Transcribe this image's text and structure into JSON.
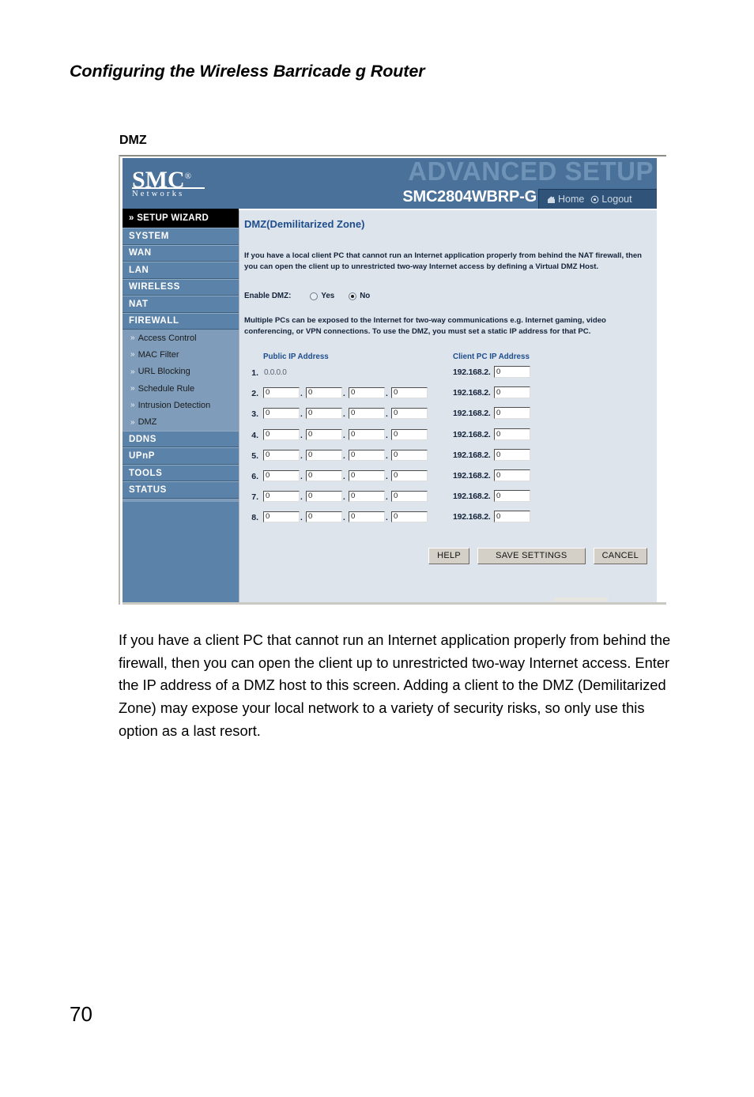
{
  "page": {
    "running_header": "Configuring the Wireless Barricade g Router",
    "section_heading": "DMZ",
    "number": "70",
    "body_paragraph": "If you have a client PC that cannot run an Internet application properly from behind the firewall, then you can open the client up to unrestricted two-way Internet access. Enter the IP address of a DMZ host to this screen. Adding a client to the DMZ (Demilitarized Zone) may expose your local network to a variety of security risks, so only use this option as a last resort."
  },
  "router_ui": {
    "banner": {
      "watermark": "ADVANCED SETUP",
      "logo_main": "SMC",
      "logo_registered": "®",
      "logo_sub": "Networks",
      "model": "SMC2804WBRP-G",
      "nav": [
        {
          "label": "Home",
          "icon": "home-icon"
        },
        {
          "label": "Logout",
          "icon": "logout-icon"
        }
      ]
    },
    "sidebar": {
      "wizard": "» SETUP WIZARD",
      "items": [
        {
          "label": "SYSTEM",
          "type": "main"
        },
        {
          "label": "WAN",
          "type": "main"
        },
        {
          "label": "LAN",
          "type": "main"
        },
        {
          "label": "WIRELESS",
          "type": "main"
        },
        {
          "label": "NAT",
          "type": "main"
        },
        {
          "label": "FIREWALL",
          "type": "main"
        },
        {
          "label": "Access Control",
          "type": "sub"
        },
        {
          "label": "MAC Filter",
          "type": "sub"
        },
        {
          "label": "URL Blocking",
          "type": "sub"
        },
        {
          "label": "Schedule Rule",
          "type": "sub"
        },
        {
          "label": "Intrusion Detection",
          "type": "sub"
        },
        {
          "label": "DMZ",
          "type": "sub"
        },
        {
          "label": "DDNS",
          "type": "main"
        },
        {
          "label": "UPnP",
          "type": "main"
        },
        {
          "label": "TOOLS",
          "type": "main"
        },
        {
          "label": "STATUS",
          "type": "main"
        }
      ]
    },
    "content": {
      "title": "DMZ(Demilitarized Zone)",
      "intro": "If you have a local client PC that cannot run an Internet application properly from behind the NAT firewall, then you can open the client up to unrestricted two-way Internet access by defining a Virtual DMZ Host.",
      "enable_label": "Enable DMZ:",
      "enable_options": [
        {
          "label": "Yes",
          "selected": false
        },
        {
          "label": "No",
          "selected": true
        }
      ],
      "note": "Multiple PCs can be exposed to the Internet for two-way communications e.g. Internet gaming, video conferencing, or VPN connections.  To use the DMZ, you must set a static IP address for that PC.",
      "columns": {
        "public": "Public IP Address",
        "client": "Client PC IP Address"
      },
      "client_prefix": "192.168.2.",
      "rows": [
        {
          "num": "1.",
          "static_public": "0.0.0.0",
          "public": [
            "",
            "",
            "",
            ""
          ],
          "client": "0"
        },
        {
          "num": "2.",
          "static_public": "",
          "public": [
            "0",
            "0",
            "0",
            "0"
          ],
          "client": "0"
        },
        {
          "num": "3.",
          "static_public": "",
          "public": [
            "0",
            "0",
            "0",
            "0"
          ],
          "client": "0"
        },
        {
          "num": "4.",
          "static_public": "",
          "public": [
            "0",
            "0",
            "0",
            "0"
          ],
          "client": "0"
        },
        {
          "num": "5.",
          "static_public": "",
          "public": [
            "0",
            "0",
            "0",
            "0"
          ],
          "client": "0"
        },
        {
          "num": "6.",
          "static_public": "",
          "public": [
            "0",
            "0",
            "0",
            "0"
          ],
          "client": "0"
        },
        {
          "num": "7.",
          "static_public": "",
          "public": [
            "0",
            "0",
            "0",
            "0"
          ],
          "client": "0"
        },
        {
          "num": "8.",
          "static_public": "",
          "public": [
            "0",
            "0",
            "0",
            "0"
          ],
          "client": "0"
        }
      ],
      "buttons": [
        {
          "label": "HELP",
          "wide": false
        },
        {
          "label": "SAVE SETTINGS",
          "wide": true
        },
        {
          "label": "CANCEL",
          "wide": false
        }
      ]
    }
  },
  "colors": {
    "banner_blue": "#4a7199",
    "sidebar_blue": "#5b82a8",
    "sidebar_sub_blue": "#7f9dbb",
    "content_bg": "#dde4ec",
    "title_blue": "#1e4d8c",
    "navbar_blue": "#2f5379"
  }
}
